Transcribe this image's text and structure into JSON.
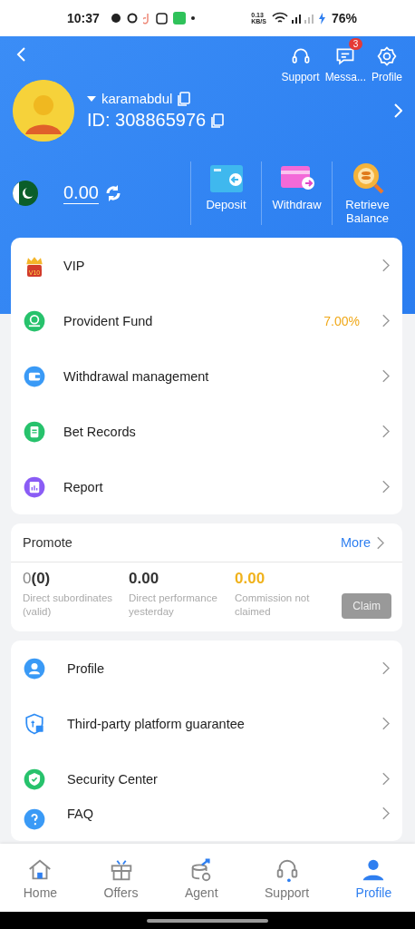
{
  "status_bar": {
    "time": "10:37",
    "net_speed": "0.13",
    "net_unit": "KB/S",
    "battery": "76%"
  },
  "header": {
    "actions": [
      {
        "kind": "support",
        "label": "Support"
      },
      {
        "kind": "messages",
        "label": "Messa...",
        "badge": "3"
      },
      {
        "kind": "settings",
        "label": "Profile"
      }
    ],
    "username": "karamabdul",
    "user_id": "ID: 308865976"
  },
  "wallet": {
    "balance": "0.00",
    "actions": [
      {
        "kind": "deposit",
        "label": "Deposit"
      },
      {
        "kind": "withdraw",
        "label": "Withdraw"
      },
      {
        "kind": "retrieve",
        "label": "Retrieve Balance"
      }
    ]
  },
  "menu": [
    {
      "kind": "vip",
      "label": "VIP",
      "badge": "V10"
    },
    {
      "kind": "fund",
      "label": "Provident Fund",
      "value": "7.00%"
    },
    {
      "kind": "wallet",
      "label": "Withdrawal management"
    },
    {
      "kind": "records",
      "label": "Bet Records"
    },
    {
      "kind": "report",
      "label": "Report"
    }
  ],
  "promote": {
    "title": "Promote",
    "more": "More",
    "stats": [
      {
        "kind": "count",
        "value": "0",
        "sub": "(0)",
        "label": "Direct subordinates (valid)"
      },
      {
        "kind": "plain",
        "value": "0.00",
        "label": "Direct performance yesterday"
      },
      {
        "kind": "highlight",
        "value": "0.00",
        "label": "Commission not claimed"
      }
    ],
    "claim": {
      "label": "Claim",
      "disabled": true
    }
  },
  "settings": [
    {
      "kind": "profile",
      "label": "Profile"
    },
    {
      "kind": "shield",
      "label": "Third-party platform guarantee"
    },
    {
      "kind": "security",
      "label": "Security Center"
    },
    {
      "kind": "faq",
      "label": "FAQ"
    }
  ],
  "nav": [
    {
      "kind": "home",
      "label": "Home",
      "selected": false
    },
    {
      "kind": "offers",
      "label": "Offers",
      "selected": false
    },
    {
      "kind": "agent",
      "label": "Agent",
      "selected": false
    },
    {
      "kind": "support",
      "label": "Support",
      "selected": false
    },
    {
      "kind": "profile",
      "label": "Profile",
      "selected": true
    }
  ]
}
